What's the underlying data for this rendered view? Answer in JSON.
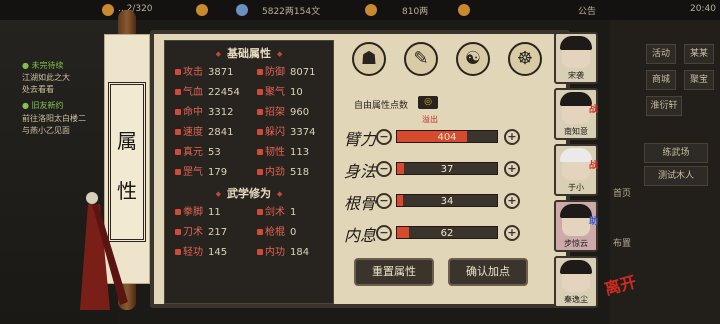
{
  "topbar": {
    "resource1": "...2/320",
    "copper": "5822两154文",
    "silver": "810两",
    "notice": "公告",
    "time": "20:40"
  },
  "quests": [
    {
      "title": "● 未完待续",
      "desc1": "江湖如此之大",
      "desc2": "处去看看"
    },
    {
      "title": "● 旧友新约",
      "desc1": "前往洛阳太白楼二",
      "desc2": "与燕小乙见面"
    }
  ],
  "scroll": {
    "seal_char1": "属",
    "seal_char2": "性"
  },
  "basic": {
    "title": "基础属性",
    "stats": [
      {
        "label": "攻击",
        "value": "3871"
      },
      {
        "label": "防御",
        "value": "8071"
      },
      {
        "label": "气血",
        "value": "22454"
      },
      {
        "label": "聚气",
        "value": "10"
      },
      {
        "label": "命中",
        "value": "3312"
      },
      {
        "label": "招架",
        "value": "960"
      },
      {
        "label": "速度",
        "value": "2841"
      },
      {
        "label": "躲闪",
        "value": "3374"
      },
      {
        "label": "真元",
        "value": "53"
      },
      {
        "label": "韧性",
        "value": "113"
      },
      {
        "label": "罡气",
        "value": "179"
      },
      {
        "label": "内劲",
        "value": "518"
      }
    ]
  },
  "martial": {
    "title": "武学修为",
    "stats": [
      {
        "label": "拳脚",
        "value": "11"
      },
      {
        "label": "剑术",
        "value": "1"
      },
      {
        "label": "刀术",
        "value": "217"
      },
      {
        "label": "枪棍",
        "value": "0"
      },
      {
        "label": "轻功",
        "value": "145"
      },
      {
        "label": "内功",
        "value": "184"
      }
    ]
  },
  "points": {
    "free_label": "自由属性点数",
    "overflow_label": "溢出",
    "rows": [
      {
        "name": "臂力",
        "value": "404",
        "fill": 0.7
      },
      {
        "name": "身法",
        "value": "37",
        "fill": 0.07
      },
      {
        "name": "根骨",
        "value": "34",
        "fill": 0.06
      },
      {
        "name": "内息",
        "value": "62",
        "fill": 0.12
      }
    ],
    "reset_label": "重置属性",
    "confirm_label": "确认加点"
  },
  "side_menu": [
    "活动",
    "某某",
    "商城",
    "聚宝",
    "淮衍轩",
    "",
    "练武场",
    "测试木人"
  ],
  "heroes": [
    {
      "name": "宋袭",
      "tag": ""
    },
    {
      "name": "南知意",
      "tag": "战"
    },
    {
      "name": "于小",
      "tag": "战"
    },
    {
      "name": "步惊云",
      "tag": "助"
    },
    {
      "name": "秦逸尘",
      "tag": ""
    }
  ],
  "side_labels": [
    "首页",
    "布置"
  ],
  "close_label": "离开",
  "colors": {
    "accent": "#d84a2e",
    "panel": "#27231f",
    "paper": "#e2d6b8"
  }
}
